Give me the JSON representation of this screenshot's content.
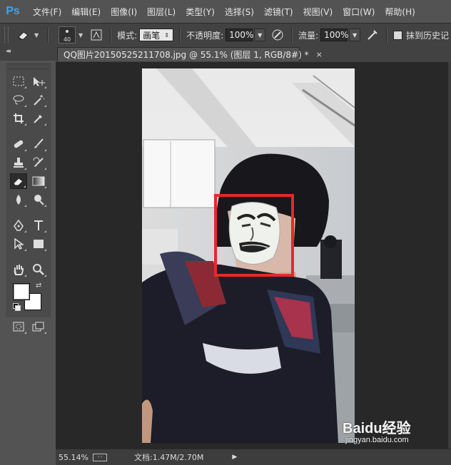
{
  "app": {
    "logo": "Ps"
  },
  "menu": [
    "文件(F)",
    "编辑(E)",
    "图像(I)",
    "图层(L)",
    "类型(Y)",
    "选择(S)",
    "滤镜(T)",
    "视图(V)",
    "窗口(W)",
    "帮助(H)"
  ],
  "options": {
    "brush_size": "40",
    "mode_label": "模式:",
    "mode_value": "画笔",
    "opacity_label": "不透明度:",
    "opacity_value": "100%",
    "flow_label": "流量:",
    "flow_value": "100%",
    "history_label": "抹到历史记"
  },
  "document": {
    "tab_title": "QQ图片20150525211708.jpg @ 55.1% (图层 1, RGB/8#) *",
    "close_symbol": "×"
  },
  "tools": {
    "colors": {
      "foreground": "#ffffff",
      "background": "#ffffff"
    }
  },
  "status": {
    "zoom": "55.14%",
    "doc_info": "文档:1.47M/2.70M"
  },
  "watermark": {
    "site": "jingyan.baidu.com",
    "brand": "Baidu经验"
  },
  "colors": {
    "accent_ps": "#31a8ff",
    "highlight_box": "#e8282a",
    "ui_dark": "#535353"
  }
}
